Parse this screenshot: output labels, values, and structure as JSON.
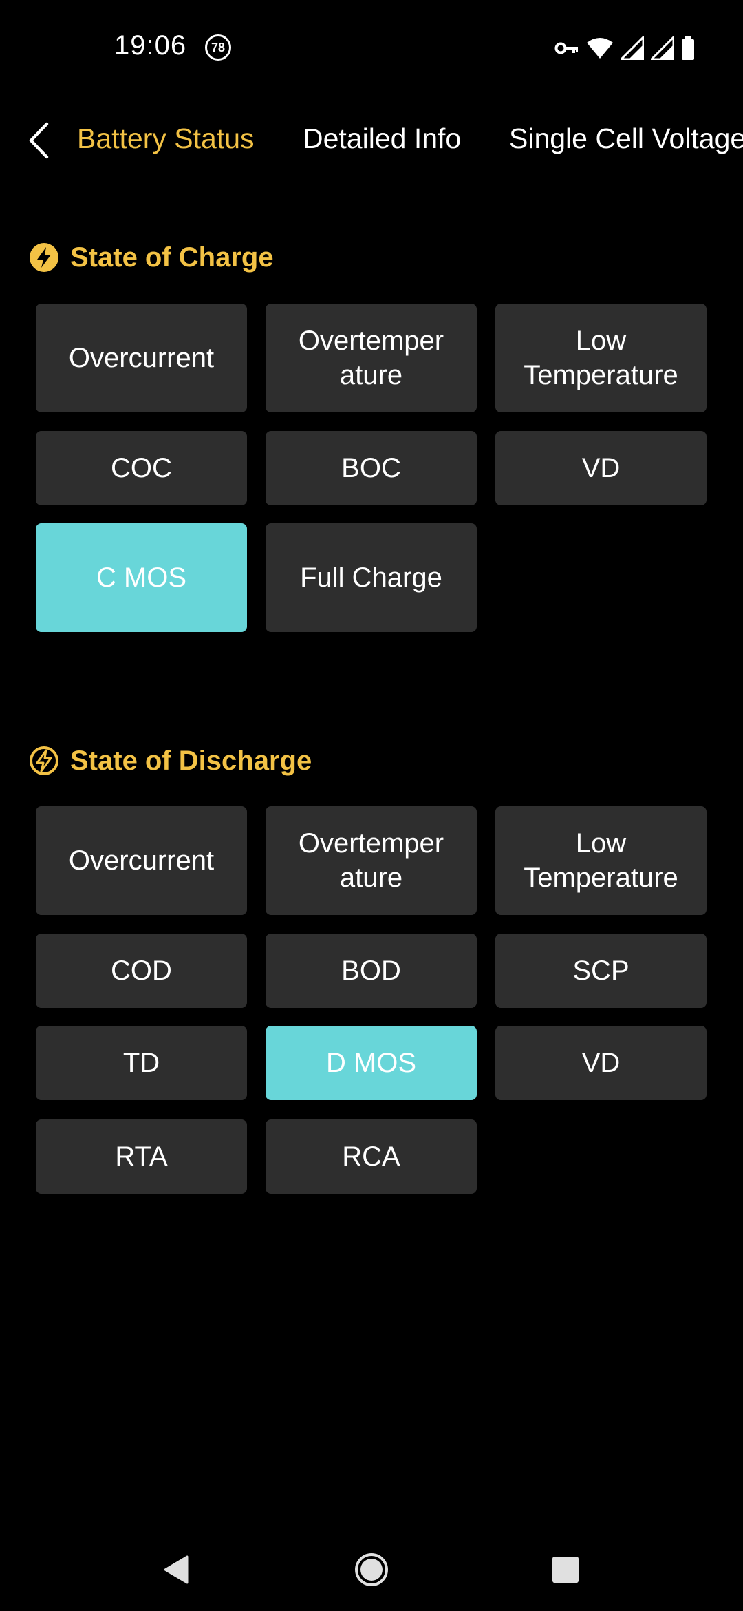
{
  "status_bar": {
    "time": "19:06",
    "badge": "78"
  },
  "tabs": [
    {
      "label": "Battery Status",
      "active": true
    },
    {
      "label": "Detailed Info",
      "active": false
    },
    {
      "label": "Single Cell Voltage",
      "active": false
    }
  ],
  "charge_section": {
    "title": "State of Charge",
    "icon": "lightning-filled-icon",
    "tiles": [
      {
        "label": "Overcurrent",
        "on": false
      },
      {
        "label": "Overtemper ature",
        "on": false
      },
      {
        "label": "Low Temperature",
        "on": false
      },
      {
        "label": "COC",
        "on": false
      },
      {
        "label": "BOC",
        "on": false
      },
      {
        "label": "VD",
        "on": false
      },
      {
        "label": "C MOS",
        "on": true
      },
      {
        "label": "Full Charge",
        "on": false
      }
    ]
  },
  "discharge_section": {
    "title": "State of Discharge",
    "icon": "lightning-outline-icon",
    "tiles": [
      {
        "label": "Overcurrent",
        "on": false
      },
      {
        "label": "Overtemper ature",
        "on": false
      },
      {
        "label": "Low Temperature",
        "on": false
      },
      {
        "label": "COD",
        "on": false
      },
      {
        "label": "BOD",
        "on": false
      },
      {
        "label": "SCP",
        "on": false
      },
      {
        "label": "TD",
        "on": false
      },
      {
        "label": "D MOS",
        "on": true
      },
      {
        "label": "VD",
        "on": false
      },
      {
        "label": "RTA",
        "on": false
      },
      {
        "label": "RCA",
        "on": false
      }
    ]
  },
  "colors": {
    "accent": "#f3c245",
    "tile_off": "#2e2e2e",
    "tile_on": "#68d6d9",
    "background": "#000000"
  }
}
